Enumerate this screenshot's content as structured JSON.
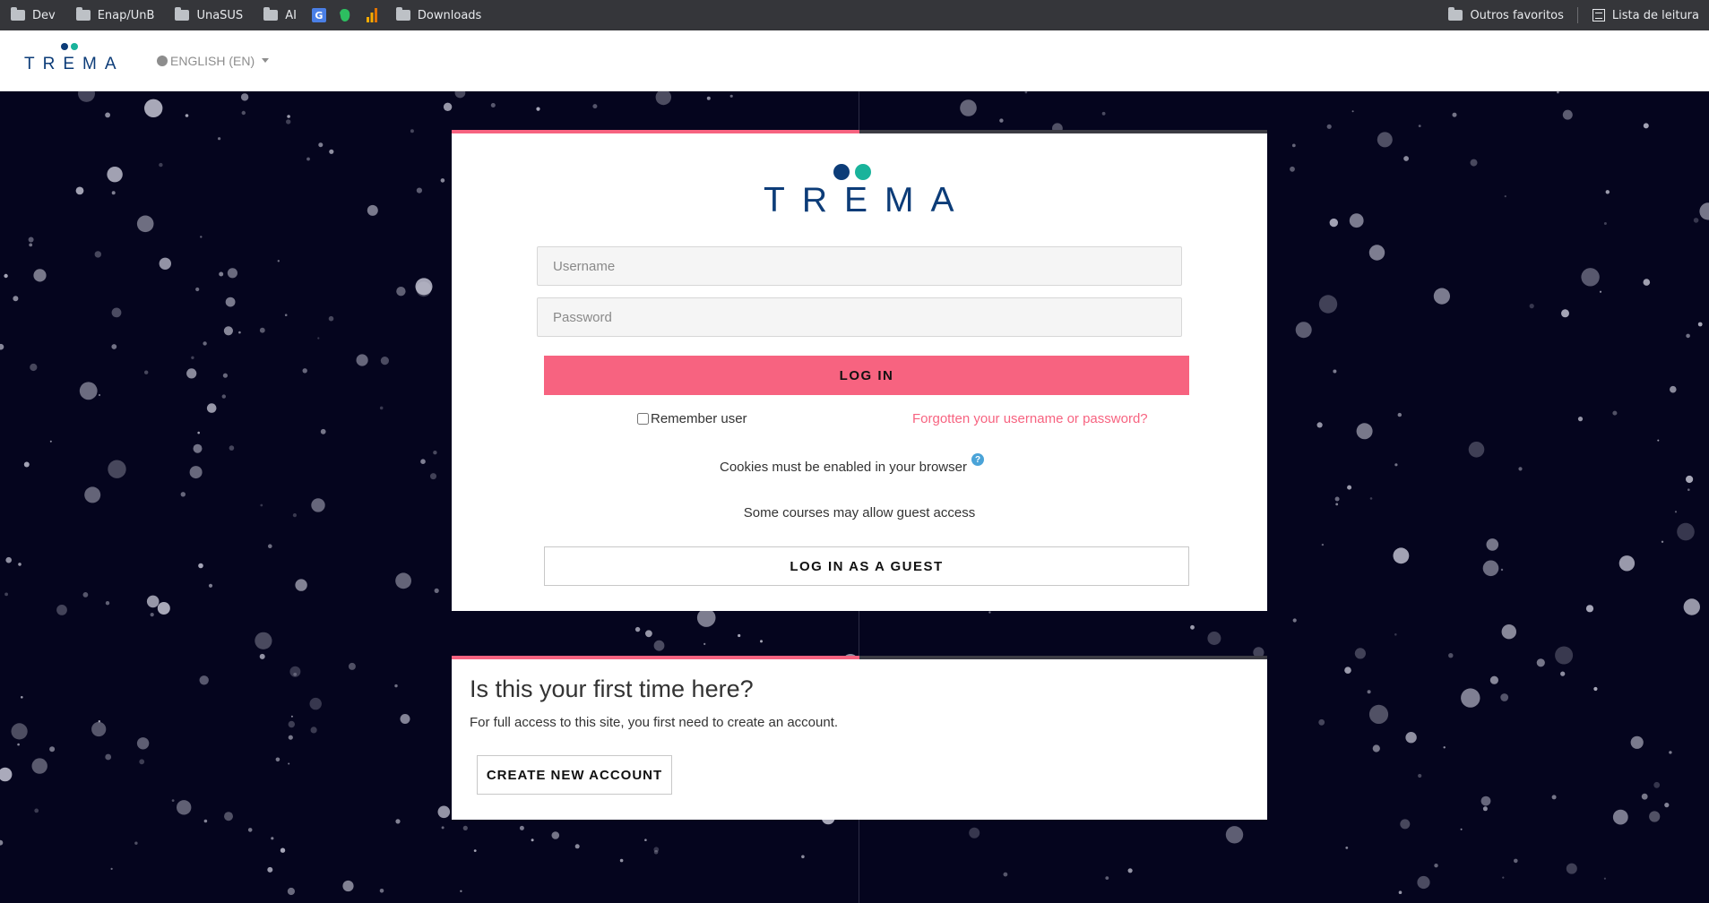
{
  "bookmarks": {
    "left": [
      {
        "label": "Dev",
        "icon": "folder-icon"
      },
      {
        "label": "Enap/UnB",
        "icon": "folder-icon"
      },
      {
        "label": "UnaSUS",
        "icon": "folder-icon"
      },
      {
        "label": "AI",
        "icon": "folder-icon"
      }
    ],
    "downloads": "Downloads",
    "outros": "Outros favoritos",
    "reading": "Lista de leitura"
  },
  "header": {
    "brand": "TREMA",
    "language": "ENGLISH (EN)"
  },
  "login": {
    "brand": "TREMA",
    "username_placeholder": "Username",
    "password_placeholder": "Password",
    "login_button": "LOG IN",
    "remember_label": "Remember user",
    "forgot_link": "Forgotten your username or password?",
    "cookies_text": "Cookies must be enabled in your browser",
    "guest_note": "Some courses may allow guest access",
    "guest_button": "LOG IN AS A GUEST"
  },
  "signup": {
    "title": "Is this your first time here?",
    "text": "For full access to this site, you first need to create an account.",
    "button": "CREATE NEW ACCOUNT"
  },
  "colors": {
    "accent": "#f76380",
    "brand_navy": "#0c3c78",
    "brand_teal": "#19b39b",
    "background": "#05051e"
  }
}
